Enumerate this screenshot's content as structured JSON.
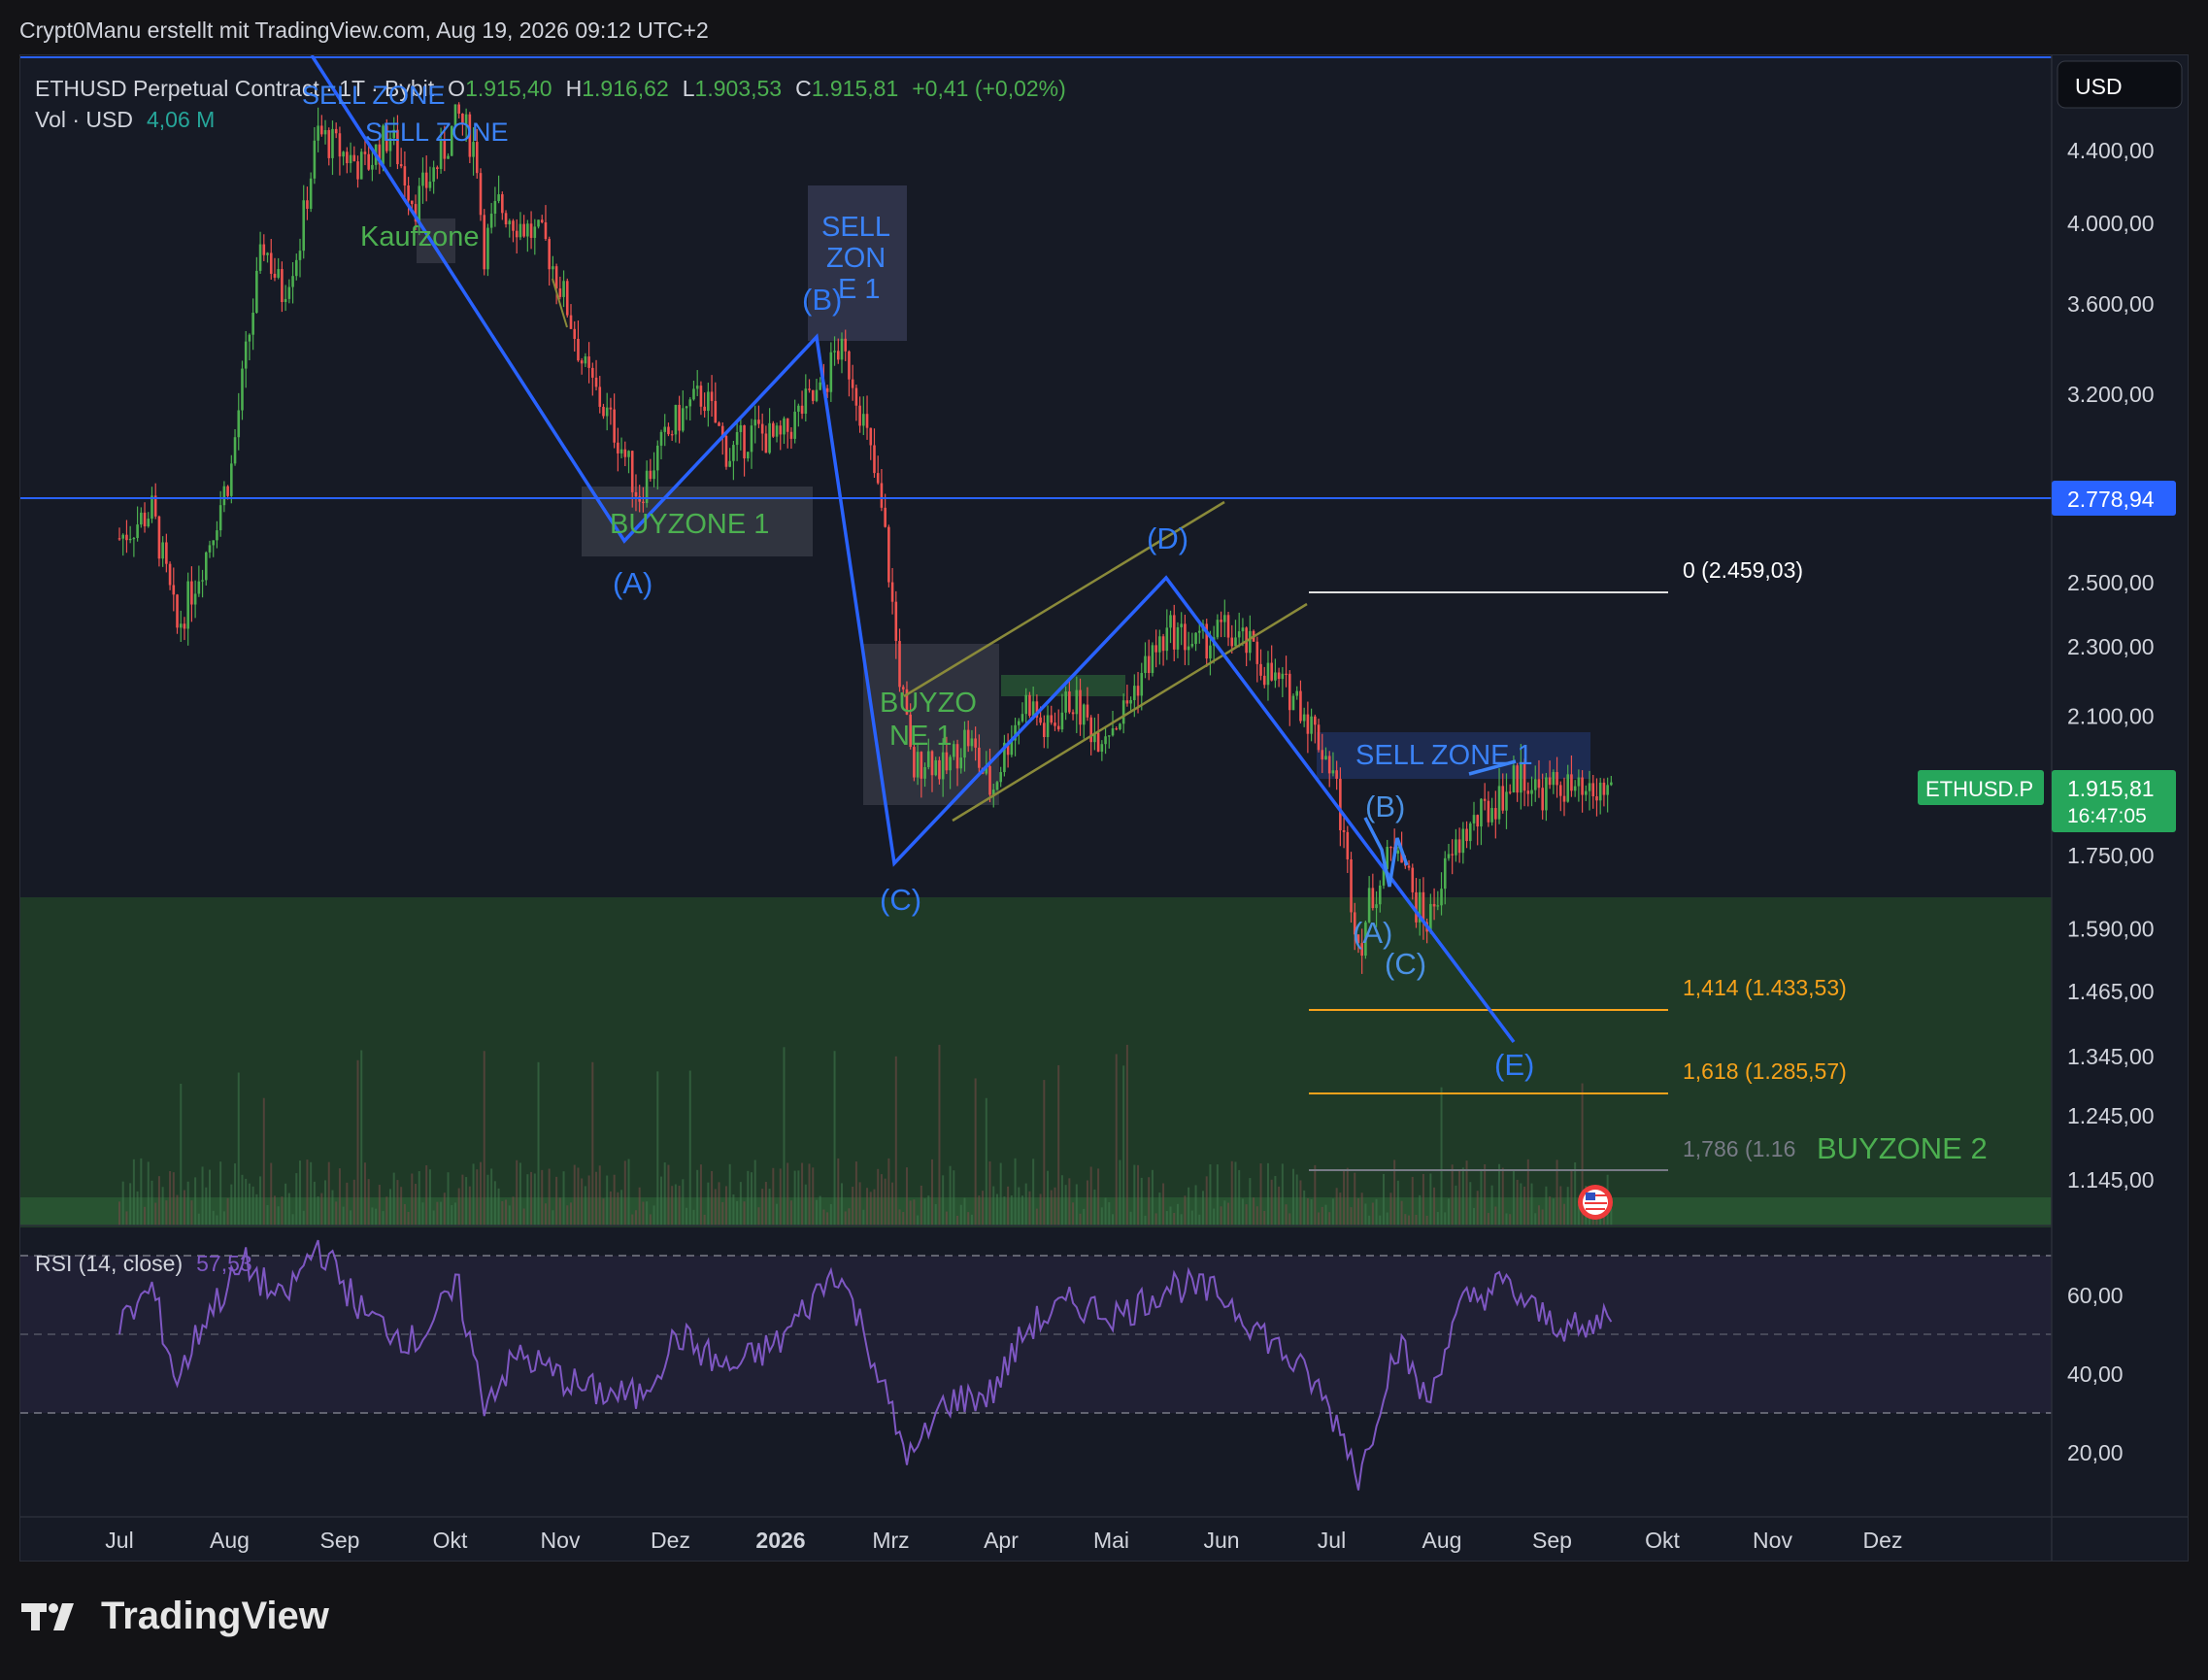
{
  "header": {
    "attribution": "Crypt0Manu erstellt mit TradingView.com, Aug 19, 2026 09:12 UTC+2"
  },
  "legend": {
    "symbol": "ETHUSD Perpetual Contract · 1T · Bybit",
    "o_label": "O",
    "o_value": "1.915,40",
    "h_label": "H",
    "h_value": "1.916,62",
    "l_label": "L",
    "l_value": "1.903,53",
    "c_label": "C",
    "c_value": "1.915,81",
    "change": "+0,41 (+0,02%)",
    "vol_label": "Vol · USD",
    "vol_value": "4,06 M"
  },
  "rsi_legend": {
    "label": "RSI (14, close)",
    "value": "57,53"
  },
  "currency_button": "USD",
  "price_badges": {
    "horizontal_line": "2.778,94",
    "symbol_tag": "ETHUSD.P",
    "last_price": "1.915,81",
    "countdown": "16:47:05"
  },
  "fib_labels": {
    "fib_0": "0 (2.459,03)",
    "fib_1414": "1,414 (1.433,53)",
    "fib_1618": "1,618 (1.285,57)",
    "fib_1786": "1,786 (1.16"
  },
  "annotations": {
    "sell_zone_top_a": "SELL ZONE",
    "sell_zone_top_b": "SELL ZONE",
    "kaufzone": "Kaufzone",
    "sell_zone_1_box_l1": "SELL",
    "sell_zone_1_box_l2": "ZON",
    "sell_zone_1_box_l3": "E 1",
    "buyzone_1": "BUYZONE 1",
    "buyzone_1b_l1": "BUYZO",
    "buyzone_1b_l2": "NE 1",
    "sell_zone_1_right": "SELL ZONE 1",
    "buyzone_2": "BUYZONE 2"
  },
  "wave_labels": {
    "a_left": "(A)",
    "b_left": "(B)",
    "c_mid": "(C)",
    "d_mid": "(D)",
    "b_right": "(B)",
    "a_right": "(A)",
    "c_right": "(C)",
    "e_right": "(E)"
  },
  "footer": {
    "brand": "TradingView"
  },
  "chart_data": {
    "type": "candlestick",
    "symbol": "ETHUSD.P",
    "timeframe": "1T",
    "exchange": "Bybit",
    "y_scale": "log",
    "price_ticks": [
      "4.400,00",
      "4.000,00",
      "3.600,00",
      "3.200,00",
      "2.500,00",
      "2.300,00",
      "2.100,00",
      "1.750,00",
      "1.590,00",
      "1.465,00",
      "1.345,00",
      "1.245,00",
      "1.145,00"
    ],
    "price_tick_values": [
      4400,
      4000,
      3600,
      3200,
      2500,
      2300,
      2100,
      1750,
      1590,
      1465,
      1345,
      1245,
      1145
    ],
    "time_ticks": [
      "Jul",
      "Aug",
      "Sep",
      "Okt",
      "Nov",
      "Dez",
      "2026",
      "Mrz",
      "Apr",
      "Mai",
      "Jun",
      "Jul",
      "Aug",
      "Sep",
      "Okt",
      "Nov",
      "Dez"
    ],
    "rsi_ticks": [
      "60,00",
      "40,00",
      "20,00"
    ],
    "rsi_tick_values": [
      60,
      40,
      20
    ],
    "rsi_bands": [
      70,
      50,
      30
    ],
    "price_path": [
      [
        "2025-07-01",
        2650
      ],
      [
        "2025-07-10",
        2750
      ],
      [
        "2025-07-17",
        2350
      ],
      [
        "2025-07-25",
        2600
      ],
      [
        "2025-08-01",
        2900
      ],
      [
        "2025-08-05",
        3350
      ],
      [
        "2025-08-10",
        3900
      ],
      [
        "2025-08-15",
        3650
      ],
      [
        "2025-08-20",
        3900
      ],
      [
        "2025-08-25",
        4500
      ],
      [
        "2025-08-31",
        4400
      ],
      [
        "2025-09-07",
        4300
      ],
      [
        "2025-09-14",
        4500
      ],
      [
        "2025-09-21",
        4100
      ],
      [
        "2025-09-28",
        4350
      ],
      [
        "2025-10-03",
        4600
      ],
      [
        "2025-10-08",
        4400
      ],
      [
        "2025-10-10",
        3850
      ],
      [
        "2025-10-14",
        4100
      ],
      [
        "2025-10-20",
        4000
      ],
      [
        "2025-10-27",
        3900
      ],
      [
        "2025-11-02",
        3600
      ],
      [
        "2025-11-07",
        3300
      ],
      [
        "2025-11-12",
        3150
      ],
      [
        "2025-11-17",
        3000
      ],
      [
        "2025-11-22",
        2800
      ],
      [
        "2025-11-27",
        2950
      ],
      [
        "2025-12-03",
        3100
      ],
      [
        "2025-12-10",
        3200
      ],
      [
        "2025-12-17",
        2950
      ],
      [
        "2025-12-24",
        3050
      ],
      [
        "2025-12-31",
        3000
      ],
      [
        "2026-01-07",
        3150
      ],
      [
        "2026-01-12",
        3200
      ],
      [
        "2026-01-16",
        3400
      ],
      [
        "2026-01-20",
        3300
      ],
      [
        "2026-01-24",
        3050
      ],
      [
        "2026-01-29",
        2700
      ],
      [
        "2026-02-02",
        2250
      ],
      [
        "2026-02-06",
        1950
      ],
      [
        "2026-02-10",
        2000
      ],
      [
        "2026-02-15",
        1950
      ],
      [
        "2026-02-21",
        2050
      ],
      [
        "2026-02-28",
        1900
      ],
      [
        "2026-03-05",
        2050
      ],
      [
        "2026-03-10",
        2150
      ],
      [
        "2026-03-15",
        2050
      ],
      [
        "2026-03-22",
        2150
      ],
      [
        "2026-03-29",
        2050
      ],
      [
        "2026-04-05",
        2100
      ],
      [
        "2026-04-12",
        2250
      ],
      [
        "2026-04-19",
        2350
      ],
      [
        "2026-04-26",
        2300
      ],
      [
        "2026-05-03",
        2350
      ],
      [
        "2026-05-10",
        2300
      ],
      [
        "2026-05-17",
        2200
      ],
      [
        "2026-05-24",
        2150
      ],
      [
        "2026-05-29",
        2050
      ],
      [
        "2026-06-03",
        1950
      ],
      [
        "2026-06-07",
        1700
      ],
      [
        "2026-06-10",
        1550
      ],
      [
        "2026-06-13",
        1650
      ],
      [
        "2026-06-17",
        1720
      ],
      [
        "2026-06-21",
        1800
      ],
      [
        "2026-06-25",
        1650
      ],
      [
        "2026-06-29",
        1600
      ],
      [
        "2026-07-03",
        1700
      ],
      [
        "2026-07-09",
        1800
      ],
      [
        "2026-07-15",
        1850
      ],
      [
        "2026-07-20",
        1900
      ],
      [
        "2026-07-25",
        1950
      ],
      [
        "2026-07-30",
        1900
      ],
      [
        "2026-08-05",
        1920
      ],
      [
        "2026-08-12",
        1880
      ],
      [
        "2026-08-19",
        1915.81
      ]
    ],
    "rsi_path": [
      [
        "2025-07-01",
        52
      ],
      [
        "2025-07-10",
        62
      ],
      [
        "2025-07-17",
        38
      ],
      [
        "2025-07-25",
        55
      ],
      [
        "2025-08-05",
        68
      ],
      [
        "2025-08-15",
        58
      ],
      [
        "2025-08-25",
        73
      ],
      [
        "2025-09-07",
        55
      ],
      [
        "2025-09-21",
        48
      ],
      [
        "2025-10-03",
        62
      ],
      [
        "2025-10-10",
        33
      ],
      [
        "2025-10-20",
        45
      ],
      [
        "2025-11-07",
        36
      ],
      [
        "2025-11-22",
        34
      ],
      [
        "2025-12-03",
        50
      ],
      [
        "2025-12-17",
        41
      ],
      [
        "2025-12-31",
        48
      ],
      [
        "2026-01-16",
        67
      ],
      [
        "2026-01-24",
        50
      ],
      [
        "2026-02-02",
        25
      ],
      [
        "2026-02-06",
        18
      ],
      [
        "2026-02-15",
        33
      ],
      [
        "2026-02-28",
        35
      ],
      [
        "2026-03-10",
        52
      ],
      [
        "2026-03-22",
        58
      ],
      [
        "2026-04-05",
        55
      ],
      [
        "2026-04-19",
        63
      ],
      [
        "2026-05-03",
        60
      ],
      [
        "2026-05-17",
        48
      ],
      [
        "2026-05-29",
        37
      ],
      [
        "2026-06-07",
        22
      ],
      [
        "2026-06-10",
        13
      ],
      [
        "2026-06-17",
        38
      ],
      [
        "2026-06-21",
        48
      ],
      [
        "2026-06-29",
        32
      ],
      [
        "2026-07-03",
        45
      ],
      [
        "2026-07-09",
        58
      ],
      [
        "2026-07-20",
        63
      ],
      [
        "2026-07-30",
        55
      ],
      [
        "2026-08-12",
        50
      ],
      [
        "2026-08-19",
        57.53
      ]
    ],
    "horizontal_line": 2778.94,
    "fibonacci": [
      {
        "label": "0 (2.459,03)",
        "value": 2459.03
      },
      {
        "label": "1,414 (1.433,53)",
        "value": 1433.53
      },
      {
        "label": "1,618 (1.285,57)",
        "value": 1285.57
      },
      {
        "label": "1,786 (1.16",
        "value": 1160
      }
    ],
    "elliott_wave_left": [
      [
        "2025-09-01",
        4620
      ],
      [
        "2025-11-28",
        2650
      ],
      [
        "2026-01-17",
        3420
      ],
      [
        "2026-02-15",
        1760
      ],
      [
        "2026-04-24",
        2490
      ],
      [
        "2026-06-25",
        1450
      ]
    ],
    "legend_values": {
      "open": 1915.4,
      "high": 1916.62,
      "low": 1903.53,
      "close": 1915.81,
      "change": 0.41,
      "change_pct": 0.02,
      "volume_musd": 4.06,
      "rsi": 57.53
    }
  },
  "colors": {
    "background": "#131316",
    "chart_bg": "#161a25",
    "up": "#26a69a",
    "up_green": "#4caf50",
    "down": "#ef5350",
    "wave_line": "#2962ff",
    "wave_label": "#3179f5",
    "buy_zone": "#1f4a2a",
    "zone_text_green": "#4caf50",
    "fib_orange": "#f7a21b",
    "rsi_line": "#7e57c2",
    "last_price_badge": "#26a65b"
  }
}
